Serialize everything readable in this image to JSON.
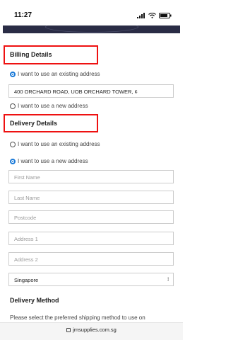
{
  "status": {
    "time": "11:27"
  },
  "billing": {
    "title": "Billing Details",
    "option_existing": "I want to use an existing address",
    "selected_address": "400 ORCHARD ROAD, UOB ORCHARD TOWER, ¢",
    "option_new": "I want to use a new address"
  },
  "delivery": {
    "title": "Delivery Details",
    "option_existing": "I want to use an existing address",
    "option_new": "I want to use a new address",
    "fields": {
      "first_name": "First Name",
      "last_name": "Last Name",
      "postcode": "Postcode",
      "address1": "Address 1",
      "address2": "Address 2"
    },
    "country": "Singapore"
  },
  "delivery_method": {
    "title": "Delivery Method",
    "text": "Please select the preferred shipping method to use on"
  },
  "browser": {
    "domain": "jmsupplies.com.sg"
  }
}
